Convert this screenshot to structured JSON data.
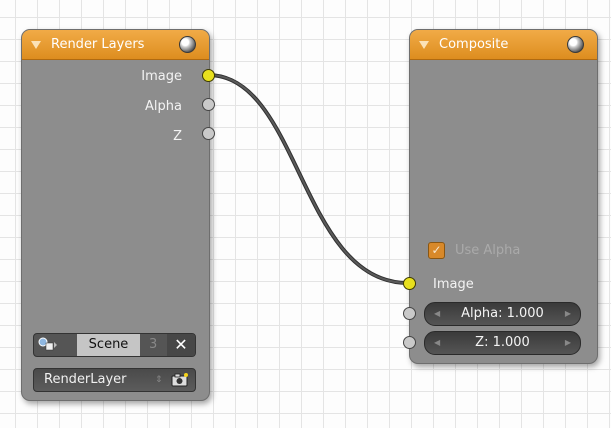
{
  "nodes": {
    "render_layers": {
      "title": "Render Layers",
      "outputs": [
        "Image",
        "Alpha",
        "Z"
      ],
      "scene_field": {
        "value": "Scene",
        "users": "3",
        "clear_symbol": "✕"
      },
      "layer_field": {
        "value": "RenderLayer"
      }
    },
    "composite": {
      "title": "Composite",
      "use_alpha": {
        "label": "Use Alpha",
        "checked": true,
        "check_symbol": "✓"
      },
      "inputs": {
        "image": "Image",
        "alpha": "Alpha: 1.000",
        "z": "Z: 1.000"
      }
    }
  },
  "icons": {
    "header_collapse": "collapse-triangle-icon",
    "header_preview": "sphere-icon",
    "scene_browse": "scene-browse-icon",
    "render_camera": "camera-icon"
  },
  "colors": {
    "header": "#e89b2c",
    "node_body": "#8d8d8d",
    "socket_color": "#e8e01e",
    "socket_value": "#c9c9c9",
    "wire": "#404040"
  }
}
